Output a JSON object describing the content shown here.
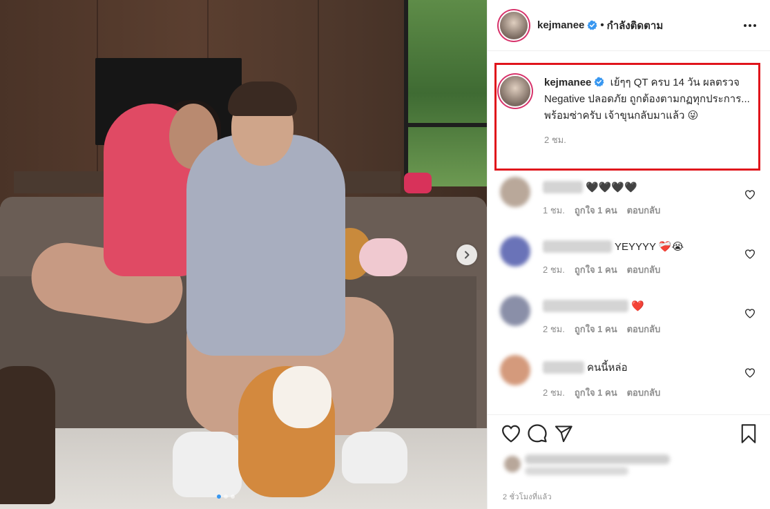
{
  "post": {
    "image_alt_semantics": "photo-of-two-people-with-corgi-on-sofa",
    "carousel": {
      "current": 1,
      "total": 3
    }
  },
  "header": {
    "username": "kejmanee",
    "separator": "•",
    "follow_status": "กำลังติดตาม"
  },
  "caption": {
    "username": "kejmanee",
    "text": "เย้ๆๆ QT ครบ 14 วัน ผลตรวจ Negative ปลอดภัย ถูกต้องตามกฏทุกประการ... พร้อมซ่าครับ เจ้าขุนกลับมาแล้ว 😜",
    "time": "2 ชม."
  },
  "comments": [
    {
      "text": "🖤🖤🖤🖤",
      "time": "1 ชม.",
      "likes": "ถูกใจ 1 คน",
      "reply": "ตอบกลับ",
      "avatar_color": "#b9a89a",
      "name_width": 58
    },
    {
      "text": "YEYYYY ❤️‍🩹😭",
      "time": "2 ชม.",
      "likes": "ถูกใจ 1 คน",
      "reply": "ตอบกลับ",
      "avatar_color": "#6a73b8",
      "name_width": 100
    },
    {
      "text": "❤️",
      "time": "2 ชม.",
      "likes": "ถูกใจ 1 คน",
      "reply": "ตอบกลับ",
      "avatar_color": "#8a8fa8",
      "name_width": 124
    },
    {
      "text": "คนนี้หล่อ",
      "time": "2 ชม.",
      "likes": "ถูกใจ 1 คน",
      "reply": "ตอบกลับ",
      "avatar_color": "#d49a7c",
      "name_width": 60
    }
  ],
  "footer": {
    "post_time": "2 ชั่วโมงที่แล้ว"
  },
  "colors": {
    "highlight_border": "#e0141b",
    "verified_blue": "#3897f0",
    "story_ring": "#d7336b",
    "muted_text": "#8e8e8e"
  }
}
